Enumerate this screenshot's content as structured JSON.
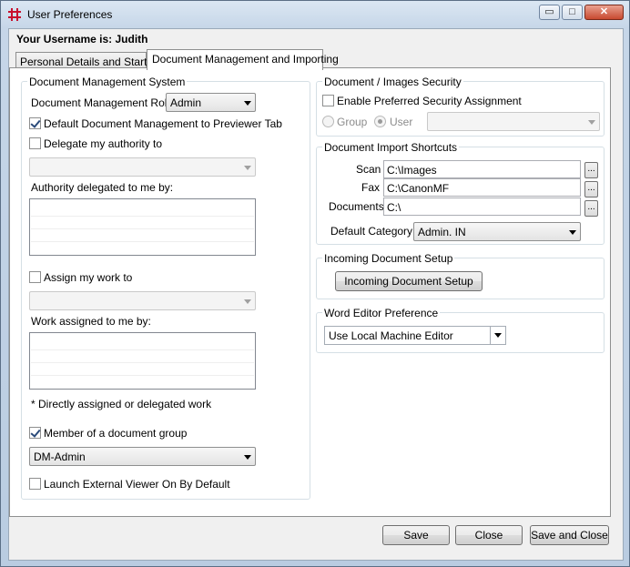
{
  "window": {
    "title": "User Preferences",
    "controls": {
      "minimize": "▭",
      "maximize": "□",
      "close": "✕"
    }
  },
  "username_label": "Your Username is: Judith",
  "tabs": [
    {
      "label": "Personal Details and Startup",
      "active": false
    },
    {
      "label": "Document Management and Importing",
      "active": true
    }
  ],
  "dms": {
    "title": "Document Management System",
    "role_label": "Document Management Role",
    "role_value": "Admin",
    "default_previewer_label": "Default Document Management to Previewer Tab",
    "default_previewer_checked": true,
    "delegate_label": "Delegate my authority to",
    "delegate_checked": false,
    "delegate_value": "",
    "authority_delegated_label": "Authority delegated to me by:",
    "assign_work_label": "Assign my work to",
    "assign_work_checked": false,
    "assign_work_value": "",
    "work_assigned_label": "Work assigned to me by:",
    "note": "* Directly assigned or delegated work",
    "member_group_label": "Member of a document  group",
    "member_group_checked": true,
    "group_value": "DM-Admin",
    "launch_external_label": "Launch External Viewer On By Default",
    "launch_external_checked": false
  },
  "security": {
    "title": "Document / Images Security",
    "enable_label": "Enable Preferred Security Assignment",
    "enable_checked": false,
    "radio_group": "Group",
    "radio_user": "User",
    "selected": "User",
    "combo_value": ""
  },
  "import_shortcuts": {
    "title": "Document Import Shortcuts",
    "scan_label": "Scan",
    "scan_value": "C:\\Images",
    "fax_label": "Fax",
    "fax_value": "C:\\CanonMF",
    "documents_label": "Documents",
    "documents_value": "C:\\",
    "browse_label": "...",
    "default_category_label": "Default Category",
    "default_category_value": "Admin. IN"
  },
  "incoming": {
    "title": "Incoming Document Setup",
    "button": "Incoming Document Setup"
  },
  "word_editor": {
    "title": "Word Editor Preference",
    "value": "Use Local Machine Editor"
  },
  "footer": {
    "save": "Save",
    "close": "Close",
    "save_and_close": "Save and Close"
  },
  "colors": {
    "app_icon": "#c8102e",
    "window_frame": "#b9cce1",
    "close_button": "#c8492f"
  },
  "icons": {
    "app": "app-logo-icon",
    "dropdown": "chevron-down-icon"
  }
}
